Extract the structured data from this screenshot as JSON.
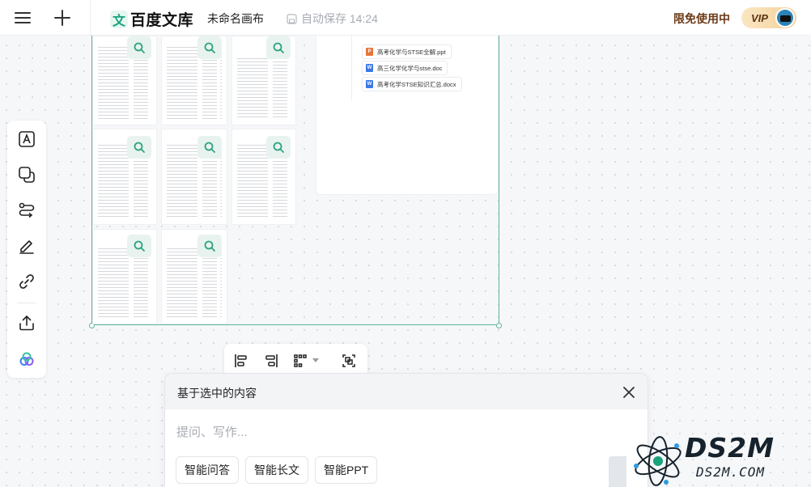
{
  "topbar": {
    "menu_icon": "hamburger-menu-icon",
    "add_icon": "plus-icon",
    "logo_mark": "文",
    "logo_text": "百度文库",
    "doc_title": "未命名画布",
    "autosave_text": "自动保存 14:24",
    "limited_text": "限免使用中",
    "vip_label": "VIP"
  },
  "left_toolbar": {
    "items": [
      {
        "name": "text-tool",
        "icon": "text-box-icon"
      },
      {
        "name": "shape-tool",
        "icon": "shapes-icon"
      },
      {
        "name": "connector-tool",
        "icon": "connector-icon"
      },
      {
        "name": "pen-tool",
        "icon": "pen-icon"
      },
      {
        "name": "link-tool",
        "icon": "link-icon"
      },
      {
        "name": "export-tool",
        "icon": "upload-icon"
      },
      {
        "name": "ai-tool",
        "icon": "ai-logo-icon"
      }
    ]
  },
  "canvas": {
    "files": [
      {
        "type": "P",
        "color": "#e8743b",
        "name": "高考化学与STSE全解.ppt"
      },
      {
        "type": "W",
        "color": "#3b78e8",
        "name": "高三化学化学与stse.doc"
      },
      {
        "type": "W",
        "color": "#3b78e8",
        "name": "高考化学STSE知识汇总.docx"
      }
    ]
  },
  "align_bar": {
    "items": [
      "align-left-icon",
      "align-right-icon",
      "distribute-grid-icon",
      "group-icon"
    ]
  },
  "ai_panel": {
    "title": "基于选中的内容",
    "placeholder": "提问、写作...",
    "chips": [
      "智能问答",
      "智能长文",
      "智能PPT"
    ]
  },
  "watermark": {
    "big": "DS2M",
    "small": "DS2M.COM"
  }
}
